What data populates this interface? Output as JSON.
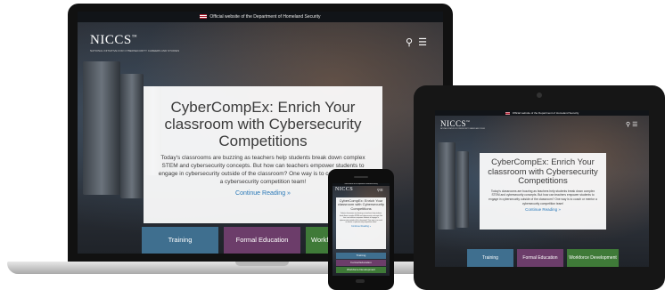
{
  "official_banner": "Official website of the Department of Homeland Security",
  "logo": {
    "text": "NICCS",
    "tm": "™",
    "subtitle": "NATIONAL INITIATIVE FOR CYBERSECURITY CAREERS AND STUDIES"
  },
  "header": {
    "search_icon": "search-icon",
    "menu_icon": "hamburger-menu-icon"
  },
  "hero": {
    "title": "CyberCompEx: Enrich Your classroom with Cybersecurity Competitions",
    "body": "Today's classrooms are buzzing as teachers help students break down complex STEM and cybersecurity concepts. But how can teachers empower students to engage in cybersecurity outside of the classroom? One way is to coach or mentor a cybersecurity competition team!",
    "link": "Continue Reading »"
  },
  "tiles": [
    {
      "label": "Training"
    },
    {
      "label": "Formal Education"
    },
    {
      "label": "Workforce Development"
    }
  ],
  "laptop_tiles": [
    "Training",
    "Formal Education",
    "Workf"
  ],
  "colors": {
    "training": "#3f6f8f",
    "formal_education": "#6c3d6a",
    "workforce_development": "#3f7a38",
    "link": "#2a78b8"
  }
}
